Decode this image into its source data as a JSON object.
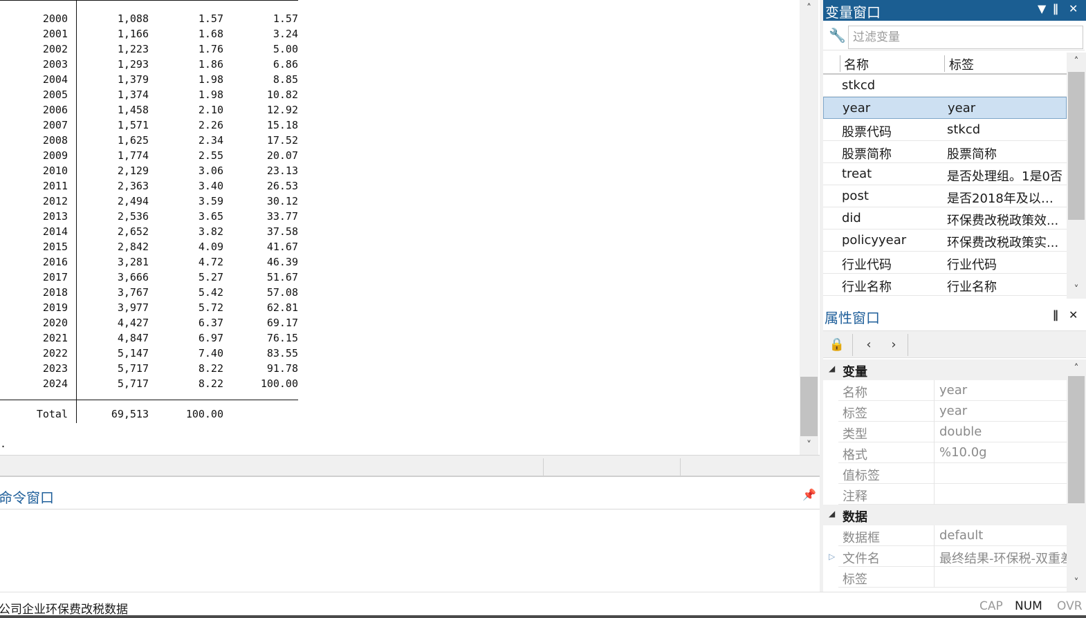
{
  "results": {
    "rows": [
      {
        "year": "2000",
        "freq": "1,088",
        "percent": "1.57",
        "cum": "1.57"
      },
      {
        "year": "2001",
        "freq": "1,166",
        "percent": "1.68",
        "cum": "3.24"
      },
      {
        "year": "2002",
        "freq": "1,223",
        "percent": "1.76",
        "cum": "5.00"
      },
      {
        "year": "2003",
        "freq": "1,293",
        "percent": "1.86",
        "cum": "6.86"
      },
      {
        "year": "2004",
        "freq": "1,379",
        "percent": "1.98",
        "cum": "8.85"
      },
      {
        "year": "2005",
        "freq": "1,374",
        "percent": "1.98",
        "cum": "10.82"
      },
      {
        "year": "2006",
        "freq": "1,458",
        "percent": "2.10",
        "cum": "12.92"
      },
      {
        "year": "2007",
        "freq": "1,571",
        "percent": "2.26",
        "cum": "15.18"
      },
      {
        "year": "2008",
        "freq": "1,625",
        "percent": "2.34",
        "cum": "17.52"
      },
      {
        "year": "2009",
        "freq": "1,774",
        "percent": "2.55",
        "cum": "20.07"
      },
      {
        "year": "2010",
        "freq": "2,129",
        "percent": "3.06",
        "cum": "23.13"
      },
      {
        "year": "2011",
        "freq": "2,363",
        "percent": "3.40",
        "cum": "26.53"
      },
      {
        "year": "2012",
        "freq": "2,494",
        "percent": "3.59",
        "cum": "30.12"
      },
      {
        "year": "2013",
        "freq": "2,536",
        "percent": "3.65",
        "cum": "33.77"
      },
      {
        "year": "2014",
        "freq": "2,652",
        "percent": "3.82",
        "cum": "37.58"
      },
      {
        "year": "2015",
        "freq": "2,842",
        "percent": "4.09",
        "cum": "41.67"
      },
      {
        "year": "2016",
        "freq": "3,281",
        "percent": "4.72",
        "cum": "46.39"
      },
      {
        "year": "2017",
        "freq": "3,666",
        "percent": "5.27",
        "cum": "51.67"
      },
      {
        "year": "2018",
        "freq": "3,767",
        "percent": "5.42",
        "cum": "57.08"
      },
      {
        "year": "2019",
        "freq": "3,977",
        "percent": "5.72",
        "cum": "62.81"
      },
      {
        "year": "2020",
        "freq": "4,427",
        "percent": "6.37",
        "cum": "69.17"
      },
      {
        "year": "2021",
        "freq": "4,847",
        "percent": "6.97",
        "cum": "76.15"
      },
      {
        "year": "2022",
        "freq": "5,147",
        "percent": "7.40",
        "cum": "83.55"
      },
      {
        "year": "2023",
        "freq": "5,717",
        "percent": "8.22",
        "cum": "91.78"
      },
      {
        "year": "2024",
        "freq": "5,717",
        "percent": "8.22",
        "cum": "100.00"
      }
    ],
    "total": {
      "label": "Total",
      "freq": "69,513",
      "percent": "100.00"
    },
    "prompt": "."
  },
  "command_window": {
    "title": "命令窗口"
  },
  "status_bar": {
    "text": "公司企业环保费改税数据",
    "indicators": [
      "CAP",
      "NUM",
      "OVR"
    ]
  },
  "variables_window": {
    "title": "变量窗口",
    "filter_placeholder": "过滤变量",
    "columns": [
      "名称",
      "标签"
    ],
    "rows": [
      {
        "name": "stkcd",
        "label": ""
      },
      {
        "name": "year",
        "label": "year",
        "selected": true
      },
      {
        "name": "股票代码",
        "label": "stkcd"
      },
      {
        "name": "股票简称",
        "label": "股票简称"
      },
      {
        "name": "treat",
        "label": "是否处理组。1是0否"
      },
      {
        "name": "post",
        "label": "是否2018年及以后..."
      },
      {
        "name": "did",
        "label": "环保费改税政策效..."
      },
      {
        "name": "policyyear",
        "label": "环保费改税政策实..."
      },
      {
        "name": "行业代码",
        "label": "行业代码"
      },
      {
        "name": "行业名称",
        "label": "行业名称"
      }
    ]
  },
  "properties_window": {
    "title": "属性窗口",
    "sections": [
      {
        "title": "变量",
        "rows": [
          {
            "key": "名称",
            "value": "year"
          },
          {
            "key": "标签",
            "value": "year"
          },
          {
            "key": "类型",
            "value": "double"
          },
          {
            "key": "格式",
            "value": "%10.0g"
          },
          {
            "key": "值标签",
            "value": ""
          },
          {
            "key": "注释",
            "value": ""
          }
        ]
      },
      {
        "title": "数据",
        "rows": [
          {
            "key": "数据框",
            "value": "default"
          },
          {
            "key": "文件名",
            "value": "最终结果-环保税-双重差"
          },
          {
            "key": "标签",
            "value": ""
          }
        ]
      }
    ]
  }
}
